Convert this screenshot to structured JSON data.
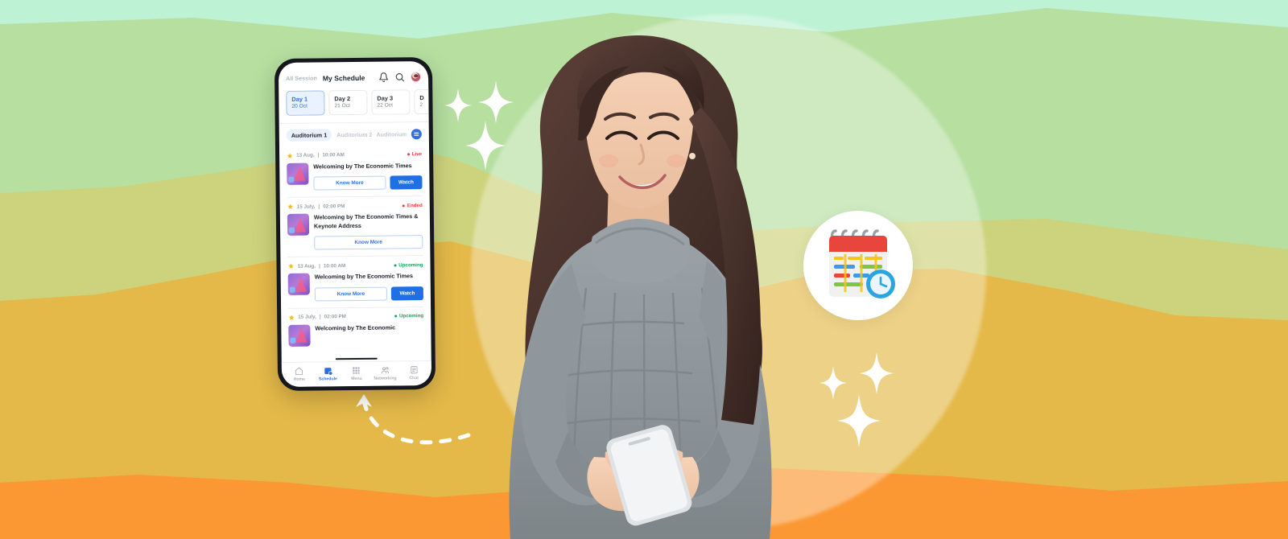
{
  "banner": {
    "background_colors": {
      "sky": "#bdf2d5",
      "green_hill": "#b6dfa0",
      "sage_hill": "#cdd37c",
      "gold_hill": "#e4b949",
      "orange_hill": "#fb9833"
    },
    "glow_color": "#ffffff",
    "sparkle_color": "#ffffff",
    "arc_color": "#ffffff"
  },
  "calendar_badge": {
    "name": "calendar-schedule-icon",
    "header_color": "#e8453c",
    "clock_color": "#2aa5e0",
    "bar_colors": [
      "#f5c518",
      "#7ac943",
      "#3d9be9",
      "#e8453c"
    ]
  },
  "phone": {
    "frame_color": "#16181d",
    "accent": "#2f6fe0",
    "header": {
      "all_session_label": "All Session",
      "my_schedule_label": "My Schedule",
      "notification_icon": "bell-icon",
      "search_icon": "search-icon",
      "avatar": "user-avatar"
    },
    "days": [
      {
        "name": "Day 1",
        "date": "20 Oct",
        "active": true
      },
      {
        "name": "Day 2",
        "date": "21 Oct",
        "active": false
      },
      {
        "name": "Day 3",
        "date": "22 Oct",
        "active": false
      },
      {
        "name": "D",
        "date": "2",
        "active": false
      }
    ],
    "auditoriums": {
      "active": "Auditorium 1",
      "second": "Auditorium 2",
      "third": "Auditorium",
      "filter_icon": "filter-list-icon"
    },
    "sessions": [
      {
        "date": "13 Aug,",
        "time": "10:00 AM",
        "status": "Live",
        "status_type": "live",
        "title": "Welcoming by The Economic Times",
        "primary_button": "Know More",
        "secondary_button": "Watch",
        "has_watch": true
      },
      {
        "date": "15 July,",
        "time": "02:00 PM",
        "status": "Ended",
        "status_type": "ended",
        "title": "Welcoming by The Economic Times & Keynote Address",
        "primary_button": "Know More",
        "secondary_button": "",
        "has_watch": false
      },
      {
        "date": "13 Aug,",
        "time": "10:00 AM",
        "status": "Upcoming",
        "status_type": "upcoming",
        "title": "Welcoming by The Economic Times",
        "primary_button": "Know More",
        "secondary_button": "Watch",
        "has_watch": true
      },
      {
        "date": "15 July,",
        "time": "02:00 PM",
        "status": "Upcoming",
        "status_type": "upcoming",
        "title": "Welcoming by The Economic",
        "primary_button": "",
        "secondary_button": "",
        "has_watch": false
      }
    ],
    "bottom_nav": [
      {
        "label": "Home",
        "icon": "home-icon",
        "active": false
      },
      {
        "label": "Schedule",
        "icon": "schedule-icon",
        "active": true
      },
      {
        "label": "Menu",
        "icon": "grid-menu-icon",
        "active": false
      },
      {
        "label": "Networking",
        "icon": "networking-people-icon",
        "active": false
      },
      {
        "label": "Chat",
        "icon": "chat-icon",
        "active": false
      }
    ]
  },
  "person": {
    "description": "woman-holding-smartphone",
    "sweater_color": "#8d959a",
    "hair_color": "#4a332c",
    "skin_color": "#f0c6aa"
  }
}
